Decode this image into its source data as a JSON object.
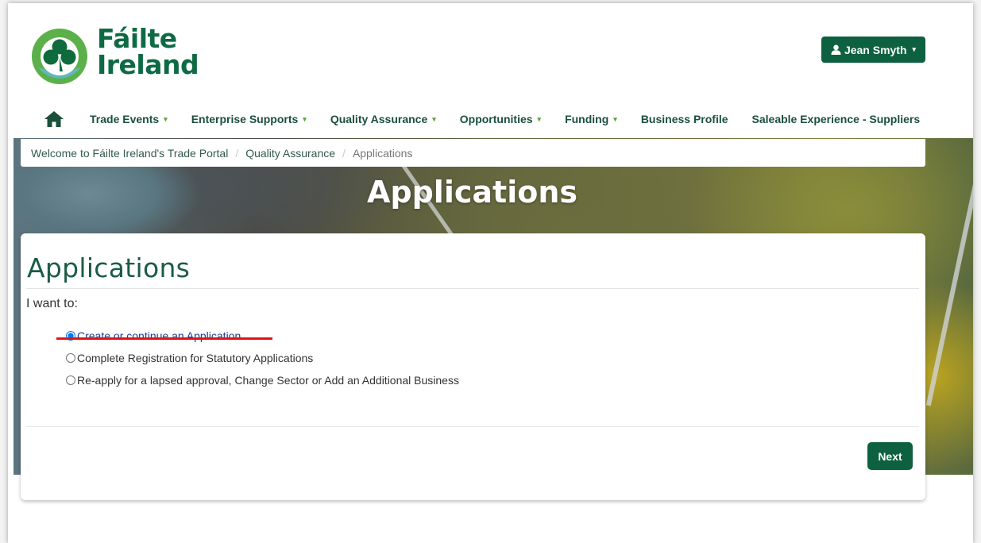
{
  "header": {
    "logo": {
      "line1": "Fáilte",
      "line2": "Ireland"
    },
    "user_button": {
      "label": "Jean Smyth",
      "icon": "user-icon"
    }
  },
  "nav": {
    "home_icon": "home-icon",
    "items": [
      {
        "label": "Trade Events",
        "dropdown": true
      },
      {
        "label": "Enterprise Supports",
        "dropdown": true
      },
      {
        "label": "Quality Assurance",
        "dropdown": true
      },
      {
        "label": "Opportunities",
        "dropdown": true
      },
      {
        "label": "Funding",
        "dropdown": true
      },
      {
        "label": "Business Profile",
        "dropdown": false
      },
      {
        "label": "Saleable Experience - Suppliers",
        "dropdown": false
      }
    ]
  },
  "breadcrumb": [
    "Welcome to Fáilte Ireland's Trade Portal",
    "Quality Assurance",
    "Applications"
  ],
  "hero": {
    "title": "Applications"
  },
  "panel": {
    "title": "Applications",
    "prompt": "I want to:",
    "options": [
      {
        "label": "Create or continue an Application",
        "checked": true
      },
      {
        "label": "Complete Registration for Statutory Applications",
        "checked": false
      },
      {
        "label": "Re-apply for a lapsed approval, Change Sector or Add an Additional Business",
        "checked": false
      }
    ],
    "next_label": "Next"
  },
  "colors": {
    "brand_green": "#0d6140",
    "nav_text": "#1b4f3b",
    "caret_green": "#5aa53b",
    "annotation_red": "#e01515"
  }
}
